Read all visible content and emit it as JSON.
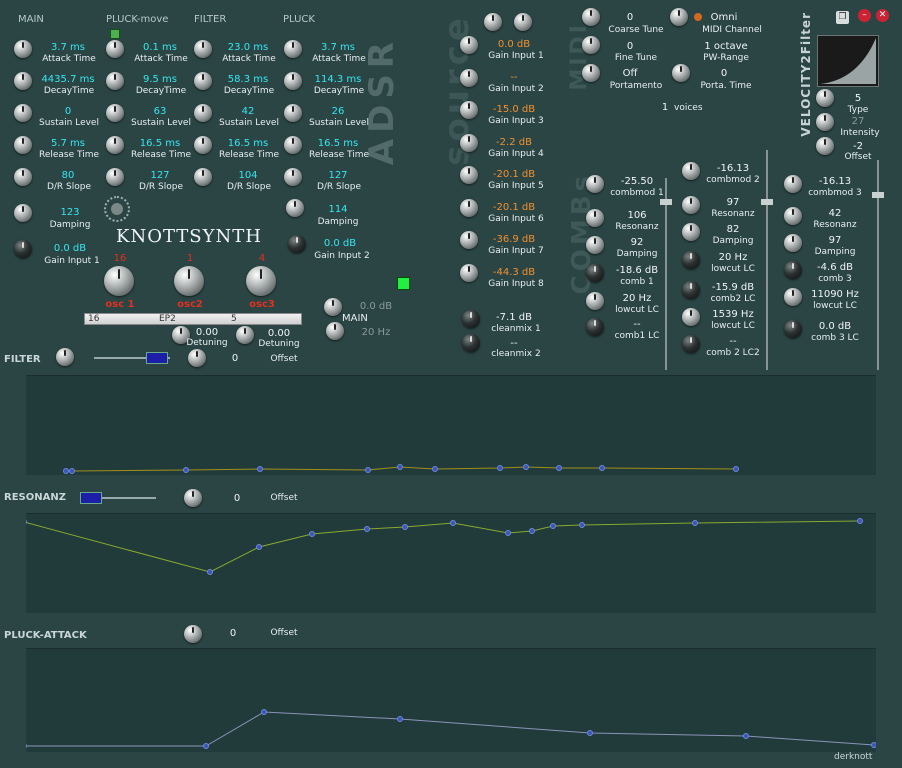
{
  "window": {
    "brand": "KNOTTSYNTH",
    "credit": "derknott",
    "buttons": {
      "copy_glyph": "❐",
      "min_glyph": "–",
      "close_glyph": "✕"
    }
  },
  "adsr": {
    "headers": [
      "MAIN",
      "PLUCK-move",
      "FILTER",
      "PLUCK"
    ],
    "side_title": "ADSR",
    "columns": [
      {
        "attack": "3.7 ms",
        "decay": "4435.7 ms",
        "sustain": "0",
        "release": "5.7 ms",
        "dr_slope": "80"
      },
      {
        "attack": "0.1 ms",
        "decay": "9.5 ms",
        "sustain": "63",
        "release": "16.5 ms",
        "dr_slope": "127"
      },
      {
        "attack": "23.0 ms",
        "decay": "58.3 ms",
        "sustain": "42",
        "release": "16.5 ms",
        "dr_slope": "104"
      },
      {
        "attack": "3.7 ms",
        "decay": "114.3 ms",
        "sustain": "26",
        "release": "16.5 ms",
        "dr_slope": "127"
      }
    ],
    "labels": {
      "attack": "Attack Time",
      "decay": "DecayTime",
      "sustain": "Sustain Level",
      "release": "Release Time",
      "dr_slope": "D/R Slope"
    },
    "damping_left": {
      "value": "123",
      "label": "Damping"
    },
    "damping_right": {
      "value": "114",
      "label": "Damping"
    },
    "gain1": {
      "value": "0.0 dB",
      "label": "Gain Input 1"
    },
    "gain2": {
      "value": "0.0 dB",
      "label": "Gain Input 2"
    }
  },
  "osc": {
    "items": [
      {
        "num": "16",
        "label": "osc 1"
      },
      {
        "num": "1",
        "label": "osc2"
      },
      {
        "num": "4",
        "label": "osc3"
      }
    ],
    "bar": [
      "16",
      "EP2",
      "5"
    ],
    "detune1": {
      "value": "0.00",
      "label": "Detuning"
    },
    "detune2": {
      "value": "0.00",
      "label": "Detuning"
    },
    "main": {
      "db": "0.0 dB",
      "label": "MAIN",
      "hz": "20 Hz"
    }
  },
  "source": {
    "title": "source",
    "gains": [
      {
        "value": "0.0 dB",
        "label": "Gain Input 1"
      },
      {
        "value": "--",
        "label": "Gain Input 2"
      },
      {
        "value": "-15.0 dB",
        "label": "Gain Input 3"
      },
      {
        "value": "-2.2 dB",
        "label": "Gain Input 4"
      },
      {
        "value": "-20.1 dB",
        "label": "Gain Input 5"
      },
      {
        "value": "-20.1 dB",
        "label": "Gain Input 6"
      },
      {
        "value": "-36.9 dB",
        "label": "Gain Input 7"
      },
      {
        "value": "-44.3 dB",
        "label": "Gain Input 8"
      }
    ],
    "cleanmix1": {
      "value": "-7.1 dB",
      "label": "cleanmix 1"
    },
    "cleanmix2": {
      "value": "--",
      "label": "cleanmix 2"
    }
  },
  "midi": {
    "title": "MIDI",
    "coarse": {
      "value": "0",
      "label": "Coarse Tune"
    },
    "fine": {
      "value": "0",
      "label": "Fine Tune"
    },
    "portamento": {
      "value": "Off",
      "label": "Portamento"
    },
    "channel": {
      "value": "Omni",
      "label": "MIDI Channel"
    },
    "pw_range": {
      "value": "1 octave",
      "label": "PW-Range"
    },
    "porta_time": {
      "value": "0",
      "label": "Porta. Time"
    },
    "voices": {
      "value": "1",
      "label": "voices"
    }
  },
  "velocity": {
    "title": "VELOCITY2Filter",
    "type": {
      "value": "5",
      "label": "Type"
    },
    "intensity": {
      "value": "27",
      "label": "Intensity"
    },
    "offset": {
      "value": "-2",
      "label": "Offset"
    }
  },
  "combs": {
    "title": "COMBs",
    "cols": [
      {
        "combmod": {
          "value": "-25.50",
          "label": "combmod 1"
        },
        "resonanz": {
          "value": "106",
          "label": "Resonanz"
        },
        "damping": {
          "value": "92",
          "label": "Damping"
        },
        "comb": {
          "value": "-18.6 dB",
          "label": "comb 1"
        },
        "lowcut": {
          "value": "20 Hz",
          "label": "lowcut LC"
        },
        "comblc": {
          "value": "--",
          "label": "comb1 LC"
        }
      },
      {
        "combmod": {
          "value": "-16.13",
          "label": "combmod 2"
        },
        "resonanz": {
          "value": "97",
          "label": "Resonanz"
        },
        "damping": {
          "value": "82",
          "label": "Damping"
        },
        "comb": {
          "value": "20 Hz",
          "label": "lowcut LC"
        },
        "lowcut": {
          "value": "-15.9 dB",
          "label": "comb2 LC"
        },
        "lowcut2": {
          "value": "1539 Hz",
          "label": "lowcut LC"
        },
        "comblc": {
          "value": "--",
          "label": "comb 2 LC2"
        }
      },
      {
        "combmod": {
          "value": "-16.13",
          "label": "combmod 3"
        },
        "resonanz": {
          "value": "42",
          "label": "Resonanz"
        },
        "damping": {
          "value": "97",
          "label": "Damping"
        },
        "comb": {
          "value": "-4.6 dB",
          "label": "comb 3"
        },
        "lowcut": {
          "value": "11090 Hz",
          "label": "lowcut LC"
        },
        "comblc": {
          "value": "0.0 dB",
          "label": "comb 3 LC"
        }
      }
    ]
  },
  "filter": {
    "label": "FILTER",
    "offset_value": "0",
    "offset_label": "Offset"
  },
  "resonanz": {
    "label": "RESONANZ",
    "offset_value": "0",
    "offset_label": "Offset"
  },
  "pluck": {
    "label": "PLUCK-ATTACK",
    "offset_value": "0",
    "offset_label": "Offset"
  },
  "colors": {
    "cyan": "#35e6f0",
    "orange": "#f09030",
    "red": "#e03020",
    "green_led": "#22ee44",
    "panel": "#213b3b"
  }
}
